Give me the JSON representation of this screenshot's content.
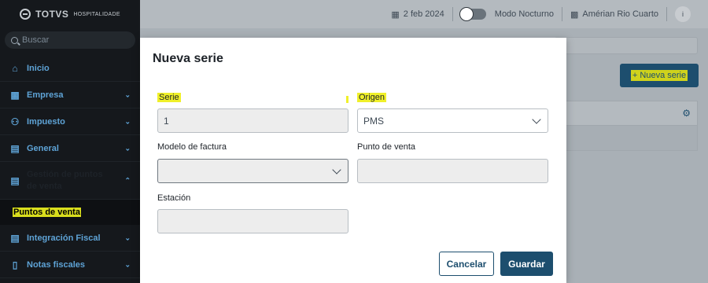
{
  "brand": {
    "name": "TOTVS",
    "tagline": "HOSPITALIDADE"
  },
  "search": {
    "placeholder": "Buscar"
  },
  "sidebar": {
    "items": [
      {
        "label": "Inicio",
        "icon": "home-icon"
      },
      {
        "label": "Empresa",
        "icon": "building-icon"
      },
      {
        "label": "Impuesto",
        "icon": "box-icon"
      },
      {
        "label": "General",
        "icon": "document-icon"
      },
      {
        "label": "Gestión de puntos de venta",
        "icon": "document-icon"
      },
      {
        "label": "Puntos de venta"
      },
      {
        "label": "Integración Fiscal",
        "icon": "document-icon"
      },
      {
        "label": "Notas fiscales",
        "icon": "file-icon"
      }
    ]
  },
  "topbar": {
    "date": "2 feb 2024",
    "night_mode_label": "Modo Nocturno",
    "hotel": "Amérian Rio Cuarto",
    "info": "i"
  },
  "page": {
    "new_button_label": "+ Nueva serie"
  },
  "modal": {
    "title": "Nueva serie",
    "serie_label": "Serie",
    "serie_value": "1",
    "origen_label": "Origen",
    "origen_value": "PMS",
    "modelo_label": "Modelo de factura",
    "modelo_value": "",
    "punto_label": "Punto de venta",
    "punto_value": "",
    "estacion_label": "Estación",
    "estacion_value": "",
    "cancel_label": "Cancelar",
    "save_label": "Guardar"
  }
}
